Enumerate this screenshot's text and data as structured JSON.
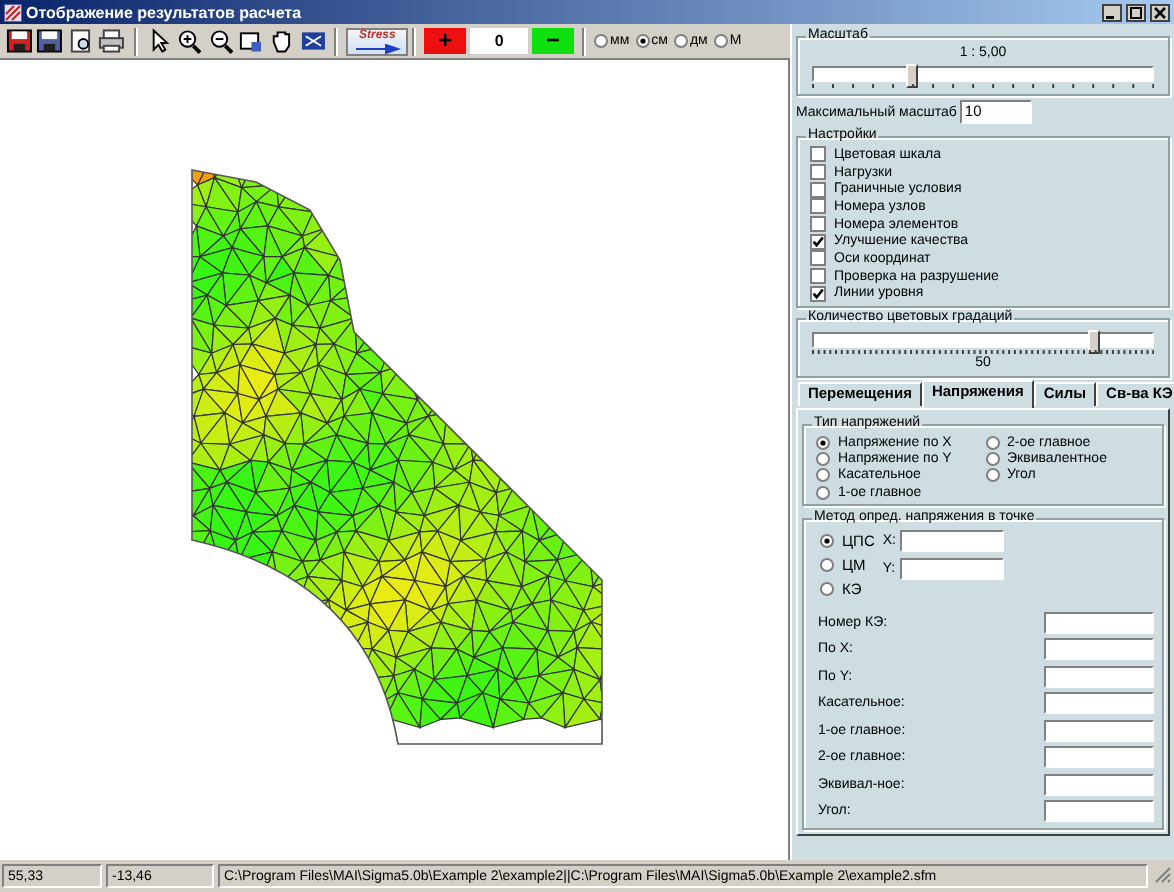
{
  "window": {
    "title": "Отображение результатов расчета"
  },
  "toolbar": {
    "stress_button": "Stress",
    "increase_button": "+",
    "value": "0",
    "decrease_button": "−",
    "units": [
      {
        "label": "мм",
        "selected": false
      },
      {
        "label": "см",
        "selected": true
      },
      {
        "label": "дм",
        "selected": false
      },
      {
        "label": "М",
        "selected": false
      }
    ]
  },
  "scale": {
    "title": "Масштаб",
    "reading": "1 : 5,00",
    "level": 0.29,
    "max_label": "Максимальный масштаб",
    "max_value": "10"
  },
  "settings": {
    "title": "Настройки",
    "items": [
      {
        "label": "Цветовая шкала",
        "checked": false
      },
      {
        "label": "Нагрузки",
        "checked": false
      },
      {
        "label": "Граничные условия",
        "checked": false
      },
      {
        "label": "Номера узлов",
        "checked": false
      },
      {
        "label": "Номера элементов",
        "checked": false
      },
      {
        "label": "Улучшение качества",
        "checked": true
      },
      {
        "label": "Оси координат",
        "checked": false
      },
      {
        "label": "Проверка на разрушение",
        "checked": false
      },
      {
        "label": "Линии уровня",
        "checked": true
      }
    ]
  },
  "gradations": {
    "title": "Количество цветовых градаций",
    "level": 0.83,
    "reading": "50"
  },
  "tabs": [
    {
      "label": "Перемещения",
      "selected": false
    },
    {
      "label": "Напряжения",
      "selected": true
    },
    {
      "label": "Силы",
      "selected": false
    },
    {
      "label": "Св-ва КЭ",
      "selected": false
    }
  ],
  "stress_type": {
    "title": "Тип напряжений",
    "options": [
      {
        "label": "Напряжение по X",
        "selected": true
      },
      {
        "label": "Напряжение по Y",
        "selected": false
      },
      {
        "label": "Касательное",
        "selected": false
      },
      {
        "label": "1-ое главное",
        "selected": false
      },
      {
        "label": "2-ое главное",
        "selected": false
      },
      {
        "label": "Эквивалентное",
        "selected": false
      },
      {
        "label": "Угол",
        "selected": false
      }
    ]
  },
  "method": {
    "title": "Метод опред. напряжения в точке",
    "options": [
      {
        "label": "ЦПС",
        "selected": true
      },
      {
        "label": "ЦМ",
        "selected": false
      },
      {
        "label": "КЭ",
        "selected": false
      }
    ],
    "x_label": "X:",
    "y_label": "Y:"
  },
  "results": [
    {
      "label": "Номер КЭ:"
    },
    {
      "label": "По X:"
    },
    {
      "label": "По Y:"
    },
    {
      "label": "Касательное:"
    },
    {
      "label": "1-ое главное:"
    },
    {
      "label": "2-ое главное:"
    },
    {
      "label": "Эквивал-ное:"
    },
    {
      "label": "Угол:"
    }
  ],
  "status_bar": [
    "55,33",
    "-13,46",
    "C:\\Program Files\\MAI\\Sigma5.0b\\Example 2\\example2||C:\\Program Files\\MAI\\Sigma5.0b\\Example 2\\example2.sfm"
  ]
}
